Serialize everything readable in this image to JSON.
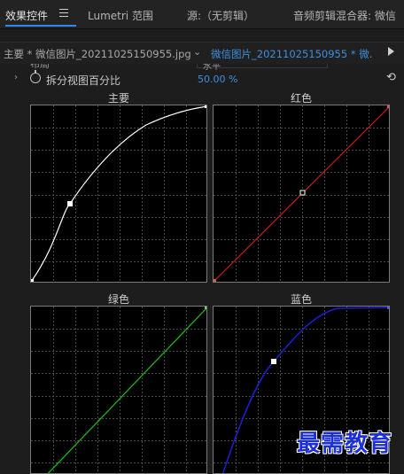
{
  "tabs": [
    {
      "label": "效果控件"
    },
    {
      "label": "Lumetri 范围"
    },
    {
      "label": "源:（无剪辑）"
    },
    {
      "label": "音频剪辑混合器: 微信"
    }
  ],
  "sequence": {
    "left_label": "主要 * 微信图片_20211025150955.jpg",
    "right_label": "微信图片_20211025150955 * 微..."
  },
  "cutoff_row": {
    "label": "布局",
    "value": "水平"
  },
  "property": {
    "label": "拆分视图百分比",
    "value": "50.00 %"
  },
  "curves": [
    {
      "title": "主要",
      "color": "#ffffff"
    },
    {
      "title": "红色",
      "color": "#cc1a1a"
    },
    {
      "title": "绿色",
      "color": "#19c219"
    },
    {
      "title": "蓝色",
      "color": "#1e1ed6"
    }
  ],
  "watermark": "最需教育",
  "icons": [
    "menu-icon",
    "chevron-down-icon",
    "expand-arrow-icon",
    "stopwatch-icon",
    "reset-icon"
  ]
}
